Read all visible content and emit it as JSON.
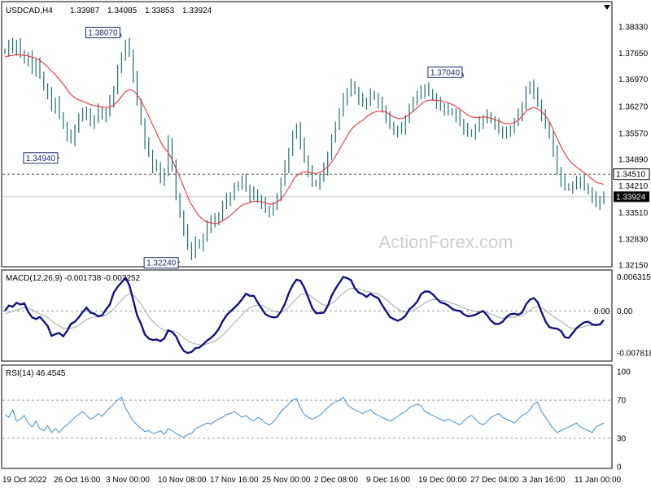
{
  "chart_data": [
    {
      "type": "ohlc",
      "panel": "price",
      "symbol_timeframe": "USDCAD,H4",
      "ohlc_header": [
        "1.33987",
        "1.34085",
        "1.33853",
        "1.33924"
      ],
      "ylim": [
        1.3215,
        1.3865
      ],
      "y_ticks": [
        "1.38330",
        "1.37650",
        "1.36970",
        "1.36270",
        "1.35570",
        "1.34890",
        "1.34210",
        "1.33510",
        "1.32830",
        "1.32150"
      ],
      "watermark": "ActionForex.com",
      "moving_average_color": "#e8343c",
      "bar_color": "#1f6f6f",
      "price_labels": [
        {
          "text": "1.38070",
          "value": 1.3807,
          "x_index": 30
        },
        {
          "text": "1.34940",
          "value": 1.3494,
          "x_index": 14
        },
        {
          "text": "1.32240",
          "value": 1.3224,
          "x_index": 45
        },
        {
          "text": "1.37040",
          "value": 1.3704,
          "x_index": 118
        }
      ],
      "dashed_level": {
        "label": "1.34510",
        "value": 1.3451
      },
      "current_price": {
        "label": "1.33924",
        "value": 1.33924
      },
      "series": [
        {
          "kind": "ohlc",
          "values": [
            1.377,
            1.3788,
            1.3775,
            1.379,
            1.3765,
            1.3745,
            1.3755,
            1.372,
            1.374,
            1.371,
            1.3675,
            1.366,
            1.3625,
            1.364,
            1.3605,
            1.3575,
            1.355,
            1.354,
            1.357,
            1.3595,
            1.3615,
            1.3605,
            1.3585,
            1.3595,
            1.362,
            1.36,
            1.361,
            1.364,
            1.367,
            1.372,
            1.376,
            1.3788,
            1.3765,
            1.3705,
            1.364,
            1.3585,
            1.353,
            1.3505,
            1.347,
            1.3475,
            1.3435,
            1.3455,
            1.3535,
            1.3475,
            1.3395,
            1.3345,
            1.3305,
            1.3265,
            1.3245,
            1.3275,
            1.3265,
            1.3285,
            1.3315,
            1.3335,
            1.3325,
            1.3345,
            1.337,
            1.3385,
            1.3395,
            1.3415,
            1.3425,
            1.3435,
            1.3415,
            1.3395,
            1.3405,
            1.3385,
            1.3375,
            1.336,
            1.3355,
            1.3365,
            1.3395,
            1.343,
            1.347,
            1.351,
            1.355,
            1.3575,
            1.353,
            1.349,
            1.346,
            1.343,
            1.3425,
            1.344,
            1.3465,
            1.35,
            1.354,
            1.358,
            1.361,
            1.3645,
            1.3665,
            1.3685,
            1.3665,
            1.3645,
            1.3635,
            1.364,
            1.366,
            1.365,
            1.3635,
            1.362,
            1.36,
            1.358,
            1.356,
            1.3565,
            1.357,
            1.3595,
            1.362,
            1.3645,
            1.3655,
            1.3665,
            1.3675,
            1.3665,
            1.365,
            1.3635,
            1.3625,
            1.362,
            1.3615,
            1.361,
            1.36,
            1.3585,
            1.357,
            1.356,
            1.3555,
            1.357,
            1.3585,
            1.3595,
            1.3605,
            1.359,
            1.358,
            1.3565,
            1.356,
            1.3555,
            1.357,
            1.3585,
            1.3605,
            1.363,
            1.3665,
            1.3685,
            1.366,
            1.3635,
            1.3605,
            1.358,
            1.355,
            1.351,
            1.346,
            1.3435,
            1.342,
            1.3415,
            1.342,
            1.343,
            1.3435,
            1.342,
            1.3405,
            1.339,
            1.3375,
            1.3385,
            1.3392
          ]
        },
        {
          "kind": "moving_average",
          "values": [
            1.3755,
            1.3758,
            1.3759,
            1.3762,
            1.3761,
            1.3759,
            1.3758,
            1.3754,
            1.3752,
            1.3747,
            1.3739,
            1.373,
            1.3719,
            1.371,
            1.3698,
            1.3686,
            1.3672,
            1.3659,
            1.365,
            1.3644,
            1.3641,
            1.3637,
            1.3632,
            1.3629,
            1.3628,
            1.3625,
            1.3624,
            1.3625,
            1.3629,
            1.3638,
            1.365,
            1.3663,
            1.367,
            1.3669,
            1.366,
            1.3645,
            1.3627,
            1.3607,
            1.3584,
            1.3564,
            1.3541,
            1.3522,
            1.3511,
            1.3494,
            1.3472,
            1.3449,
            1.3425,
            1.34,
            1.3377,
            1.3361,
            1.3346,
            1.3335,
            1.3328,
            1.3326,
            1.3323,
            1.3324,
            1.3328,
            1.3334,
            1.3341,
            1.335,
            1.3359,
            1.3368,
            1.3373,
            1.3376,
            1.338,
            1.3381,
            1.338,
            1.3378,
            1.3374,
            1.3373,
            1.3376,
            1.3383,
            1.3393,
            1.3408,
            1.3424,
            1.3442,
            1.3451,
            1.3456,
            1.3457,
            1.3455,
            1.3453,
            1.3454,
            1.3457,
            1.3465,
            1.3475,
            1.3489,
            1.3505,
            1.3523,
            1.354,
            1.3558,
            1.3571,
            1.358,
            1.3587,
            1.3594,
            1.3603,
            1.3609,
            1.3613,
            1.3615,
            1.3614,
            1.361,
            1.3603,
            1.3598,
            1.3595,
            1.3596,
            1.3601,
            1.3609,
            1.3617,
            1.3626,
            1.3635,
            1.3641,
            1.3643,
            1.3643,
            1.3642,
            1.3641,
            1.3638,
            1.3635,
            1.3631,
            1.3625,
            1.3618,
            1.361,
            1.3603,
            1.3599,
            1.3598,
            1.3598,
            1.36,
            1.3598,
            1.3596,
            1.3592,
            1.3588,
            1.3584,
            1.3582,
            1.3582,
            1.3586,
            1.3592,
            1.3603,
            1.3616,
            1.3622,
            1.3624,
            1.362,
            1.3612,
            1.3601,
            1.3586,
            1.3564,
            1.3542,
            1.3521,
            1.3502,
            1.3488,
            1.3477,
            1.3469,
            1.3462,
            1.3454,
            1.3446,
            1.3438,
            1.343,
            1.3427,
            1.3425
          ]
        }
      ]
    },
    {
      "type": "line",
      "panel": "macd",
      "title": "MACD(12,26,9) -0.001738 -0.002252",
      "ylim": [
        -0.009,
        0.007
      ],
      "y_ticks": [
        "0.006315",
        "0.00",
        "-0.007818"
      ],
      "zero_label": "0.00",
      "series": [
        {
          "name": "MACD",
          "color": "#13137f",
          "values": [
            0.0,
            0.001,
            0.0008,
            0.0015,
            0.0012,
            0.0014,
            -0.0002,
            -0.0012,
            -0.0015,
            -0.0011,
            -0.0019,
            -0.0028,
            -0.0046,
            -0.0043,
            -0.0041,
            -0.0047,
            -0.0037,
            -0.0024,
            -0.002,
            -0.0012,
            -0.0002,
            0.0006,
            -0.0003,
            -0.0005,
            -0.001,
            -0.0008,
            0.0003,
            0.0012,
            0.0034,
            0.0045,
            0.0053,
            0.0062,
            0.0048,
            0.002,
            -0.0008,
            -0.0024,
            -0.0044,
            -0.0051,
            -0.0054,
            -0.0053,
            -0.0056,
            -0.0051,
            -0.0036,
            -0.0039,
            -0.0047,
            -0.0063,
            -0.0074,
            -0.0078,
            -0.0076,
            -0.0069,
            -0.0068,
            -0.0062,
            -0.0055,
            -0.005,
            -0.0043,
            -0.0033,
            -0.0019,
            -0.0008,
            -0.0001,
            0.0006,
            0.0013,
            0.0022,
            0.0032,
            0.0028,
            0.0028,
            0.0016,
            0.0005,
            -0.0006,
            -0.001,
            -0.0012,
            -0.0011,
            -0.0001,
            0.0013,
            0.0033,
            0.0048,
            0.0058,
            0.0056,
            0.0043,
            0.0025,
            0.0006,
            -0.0004,
            -0.0004,
            -0.0003,
            0.0009,
            0.0028,
            0.0041,
            0.0052,
            0.0063,
            0.0061,
            0.0057,
            0.0042,
            0.0034,
            0.0031,
            0.0026,
            0.0032,
            0.0027,
            0.0024,
            0.0011,
            0.0,
            -0.0011,
            -0.0015,
            -0.0018,
            -0.0015,
            -0.0009,
            0.0003,
            0.0009,
            0.0017,
            0.0031,
            0.0036,
            0.0036,
            0.0031,
            0.0023,
            0.0016,
            0.0014,
            0.001,
            0.0004,
            0.0001,
            0.0,
            -0.0006,
            -0.001,
            -0.0009,
            -0.0007,
            -0.0003,
            0.0,
            -0.0008,
            -0.0018,
            -0.0024,
            -0.0024,
            -0.002,
            -0.0011,
            -0.0006,
            -0.0005,
            -0.0007,
            -0.0003,
            0.0012,
            0.0021,
            0.0024,
            0.0016,
            -0.0002,
            -0.0019,
            -0.003,
            -0.0032,
            -0.0033,
            -0.0037,
            -0.0049,
            -0.005,
            -0.0041,
            -0.0032,
            -0.0026,
            -0.0021,
            -0.002,
            -0.0025,
            -0.0026,
            -0.0025,
            -0.0017
          ]
        },
        {
          "name": "Signal",
          "color": "#a6a6a6",
          "values": [
            -0.0005,
            -0.0003,
            -0.0001,
            0.0002,
            0.0004,
            0.0006,
            0.0005,
            0.0002,
            -0.0002,
            -0.0005,
            -0.0008,
            -0.0012,
            -0.0019,
            -0.0024,
            -0.0028,
            -0.0032,
            -0.0033,
            -0.0032,
            -0.003,
            -0.0026,
            -0.0021,
            -0.0016,
            -0.0013,
            -0.0011,
            -0.0011,
            -0.001,
            -0.0007,
            -0.0003,
            0.0004,
            0.0012,
            0.002,
            0.0028,
            0.0032,
            0.003,
            0.0022,
            0.0013,
            0.0001,
            -0.001,
            -0.0019,
            -0.0026,
            -0.0032,
            -0.0036,
            -0.0036,
            -0.0037,
            -0.0039,
            -0.0044,
            -0.005,
            -0.0055,
            -0.0059,
            -0.0061,
            -0.0063,
            -0.0063,
            -0.0061,
            -0.0059,
            -0.0056,
            -0.0051,
            -0.0045,
            -0.0037,
            -0.003,
            -0.0022,
            -0.0015,
            -0.0007,
            0.0001,
            0.0006,
            0.001,
            0.0011,
            0.001,
            0.0007,
            0.0003,
            0.0,
            -0.0002,
            -0.0002,
            0.0001,
            0.0007,
            0.0015,
            0.0023,
            0.003,
            0.0032,
            0.0031,
            0.0026,
            0.002,
            0.0015,
            0.0011,
            0.001,
            0.0014,
            0.0019,
            0.0026,
            0.0033,
            0.0039,
            0.0042,
            0.0042,
            0.0041,
            0.0039,
            0.0036,
            0.0035,
            0.0033,
            0.0031,
            0.0027,
            0.0022,
            0.0015,
            0.0009,
            0.0004,
            0.0,
            -0.0002,
            -0.0001,
            0.0001,
            0.0005,
            0.001,
            0.0015,
            0.0019,
            0.0021,
            0.0021,
            0.002,
            0.0019,
            0.0017,
            0.0014,
            0.0012,
            0.0009,
            0.0006,
            0.0003,
            0.0001,
            -0.0001,
            -0.0001,
            -0.0001,
            -0.0003,
            -0.0006,
            -0.0009,
            -0.0012,
            -0.0014,
            -0.0013,
            -0.0012,
            -0.0011,
            -0.001,
            -0.0009,
            -0.0004,
            0.0001,
            0.0006,
            0.0008,
            0.0006,
            0.0001,
            -0.0005,
            -0.001,
            -0.0015,
            -0.0019,
            -0.0025,
            -0.003,
            -0.0032,
            -0.0032,
            -0.0031,
            -0.0029,
            -0.0027,
            -0.0027,
            -0.0027,
            -0.0026,
            -0.0024
          ]
        }
      ]
    },
    {
      "type": "line",
      "panel": "rsi",
      "title": "RSI(14) 46.4545",
      "ylim": [
        0,
        100
      ],
      "y_ticks": [
        "100",
        "70",
        "30",
        "0"
      ],
      "x_ticks": [
        "19 Oct 2022",
        "26 Oct 16:00",
        "3 Nov 00:00",
        "10 Nov 08:00",
        "17 Nov 16:00",
        "25 Nov 00:00",
        "2 Dec 08:00",
        "9 Dec 16:00",
        "19 Dec 00:00",
        "27 Dec 04:00",
        "3 Jan 16:00",
        "11 Jan 00:00"
      ],
      "series": [
        {
          "name": "RSI",
          "color": "#3a8fd6",
          "values": [
            55,
            52,
            60,
            48,
            50,
            54,
            46,
            42,
            48,
            40,
            38,
            43,
            36,
            40,
            36,
            41,
            44,
            48,
            52,
            55,
            58,
            54,
            50,
            52,
            56,
            53,
            58,
            62,
            66,
            70,
            73,
            62,
            55,
            48,
            44,
            40,
            37,
            38,
            35,
            36,
            38,
            34,
            40,
            38,
            35,
            33,
            31,
            34,
            35,
            40,
            42,
            44,
            46,
            45,
            48,
            50,
            52,
            55,
            56,
            58,
            55,
            52,
            54,
            50,
            48,
            52,
            50,
            46,
            44,
            47,
            52,
            58,
            62,
            66,
            70,
            72,
            62,
            55,
            52,
            50,
            52,
            54,
            58,
            62,
            66,
            68,
            70,
            73,
            66,
            62,
            60,
            58,
            56,
            58,
            60,
            56,
            54,
            52,
            50,
            48,
            50,
            53,
            56,
            58,
            62,
            64,
            66,
            64,
            58,
            56,
            54,
            52,
            50,
            48,
            50,
            48,
            46,
            44,
            48,
            52,
            54,
            50,
            46,
            44,
            48,
            52,
            54,
            56,
            52,
            50,
            48,
            46,
            50,
            54,
            56,
            60,
            66,
            68,
            58,
            52,
            46,
            40,
            36,
            38,
            40,
            42,
            44,
            46,
            42,
            40,
            38,
            36,
            42,
            44,
            46
          ]
        }
      ]
    }
  ]
}
